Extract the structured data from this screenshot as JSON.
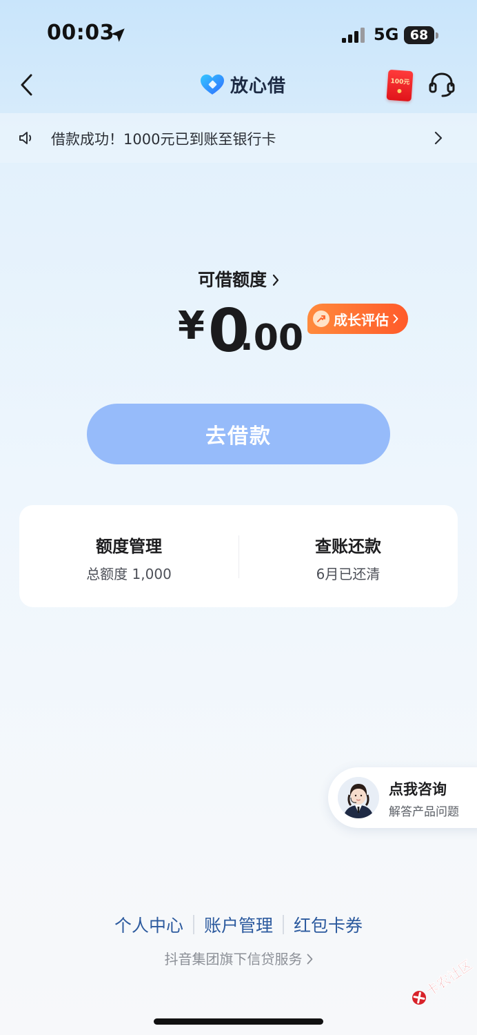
{
  "status_bar": {
    "time": "00:03",
    "network": "5G",
    "battery": "68",
    "icons": [
      "location-arrow-icon",
      "signal-icon",
      "battery-icon"
    ]
  },
  "nav": {
    "back_icon": "chevron-left-icon",
    "brand_name": "放心借",
    "brand_logo": "heart-logo",
    "redpacket_label": "100元",
    "service_icon": "headset-icon"
  },
  "notice": {
    "icon": "speaker-icon",
    "text": "借款成功！1000元已到账至银行卡"
  },
  "credit": {
    "label": "可借额度",
    "currency": "¥",
    "amount_int": "0",
    "amount_dec": ".00",
    "growth_label": "成长评估"
  },
  "borrow_button": "去借款",
  "card": {
    "left": {
      "title": "额度管理",
      "subtitle": "总额度 1,000"
    },
    "right": {
      "title": "查账还款",
      "subtitle": "6月已还清"
    }
  },
  "consult": {
    "title": "点我咨询",
    "subtitle": "解答产品问题"
  },
  "footer": {
    "links": [
      "个人中心",
      "账户管理",
      "红包卡券"
    ],
    "note": "抖音集团旗下信贷服务"
  },
  "watermark": "卡农社区",
  "colors": {
    "primary_button": "#96bbfa",
    "badge_orange": "#ff6a30",
    "link_blue": "#2c5a9e",
    "redpacket_red": "#e0141a"
  }
}
